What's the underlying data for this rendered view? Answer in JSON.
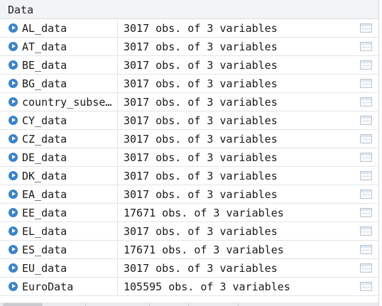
{
  "section": {
    "title": "Data"
  },
  "rows": [
    {
      "name": "AL_data",
      "value": "3017 obs. of 3 variables"
    },
    {
      "name": "AT_data",
      "value": "3017 obs. of 3 variables"
    },
    {
      "name": "BE_data",
      "value": "3017 obs. of 3 variables"
    },
    {
      "name": "BG_data",
      "value": "3017 obs. of 3 variables"
    },
    {
      "name": "country_subse…",
      "value": "3017 obs. of 3 variables"
    },
    {
      "name": "CY_data",
      "value": "3017 obs. of 3 variables"
    },
    {
      "name": "CZ_data",
      "value": "3017 obs. of 3 variables"
    },
    {
      "name": "DE_data",
      "value": "3017 obs. of 3 variables"
    },
    {
      "name": "DK_data",
      "value": "3017 obs. of 3 variables"
    },
    {
      "name": "EA_data",
      "value": "3017 obs. of 3 variables"
    },
    {
      "name": "EE_data",
      "value": "17671 obs. of 3 variables"
    },
    {
      "name": "EL_data",
      "value": "3017 obs. of 3 variables"
    },
    {
      "name": "ES_data",
      "value": "17671 obs. of 3 variables"
    },
    {
      "name": "EU_data",
      "value": "3017 obs. of 3 variables"
    },
    {
      "name": "EuroData",
      "value": "105595 obs. of 3 variables"
    }
  ],
  "icons": {
    "expand": "expand-arrow-icon",
    "view": "data-grid-icon"
  },
  "colors": {
    "expand_icon": "#3b83c8",
    "header_bg": "#f2f3f5",
    "row_border": "#e2e4e7"
  }
}
